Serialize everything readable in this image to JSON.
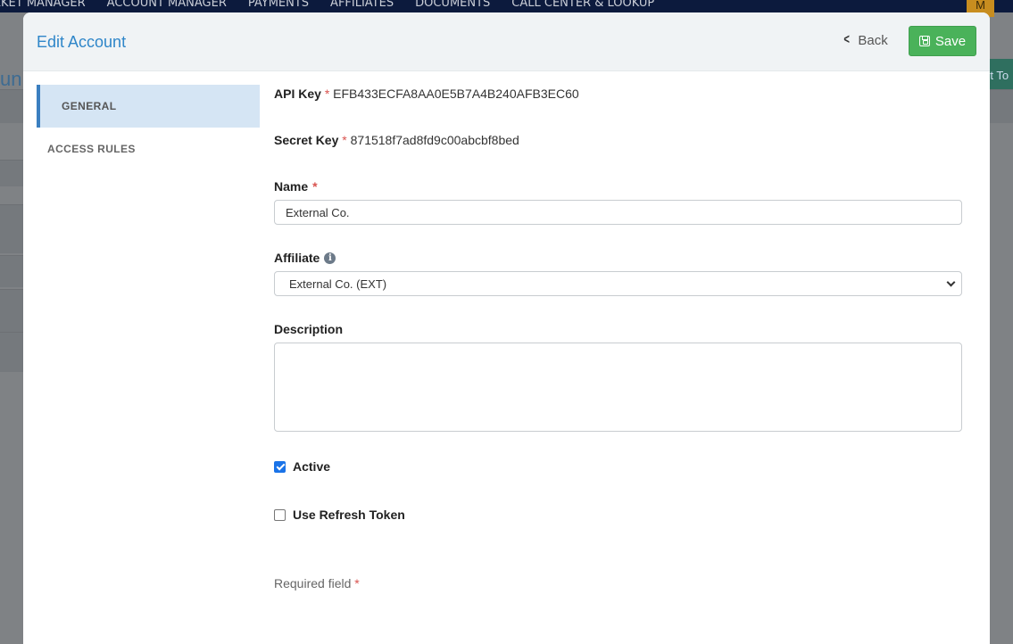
{
  "background": {
    "nav_items": [
      "RKET MANAGER",
      "ACCOUNT MANAGER",
      "PAYMENTS",
      "AFFILIATES",
      "DOCUMENTS",
      "CALL CENTER & LOOKUP"
    ],
    "avatar_initial": "M",
    "page_title_fragment": "un",
    "button_fragment": "rt To"
  },
  "modal": {
    "title": "Edit Account",
    "back_label": "Back",
    "save_label": "Save"
  },
  "sidebar": {
    "items": [
      {
        "label": "GENERAL",
        "active": true
      },
      {
        "label": "ACCESS RULES",
        "active": false
      }
    ]
  },
  "form": {
    "api_key": {
      "label": "API Key",
      "required": "*",
      "value": "EFB433ECFA8AA0E5B7A4B240AFB3EC60"
    },
    "secret_key": {
      "label": "Secret Key",
      "required": "*",
      "value": "871518f7ad8fd9c00abcbf8bed"
    },
    "name": {
      "label": "Name",
      "required": "*",
      "value": "External Co."
    },
    "affiliate": {
      "label": "Affiliate",
      "info_icon": "i",
      "selected": "External Co. (EXT)"
    },
    "description": {
      "label": "Description",
      "value": ""
    },
    "active": {
      "label": "Active",
      "checked": true
    },
    "use_refresh_token": {
      "label": "Use Refresh Token",
      "checked": false
    },
    "required_note": {
      "text": "Required field",
      "marker": "*"
    }
  },
  "colors": {
    "accent": "#2f86c9",
    "save": "#4ab25a",
    "required": "#d9534f",
    "sidebar_active": "#d5e5f4"
  }
}
